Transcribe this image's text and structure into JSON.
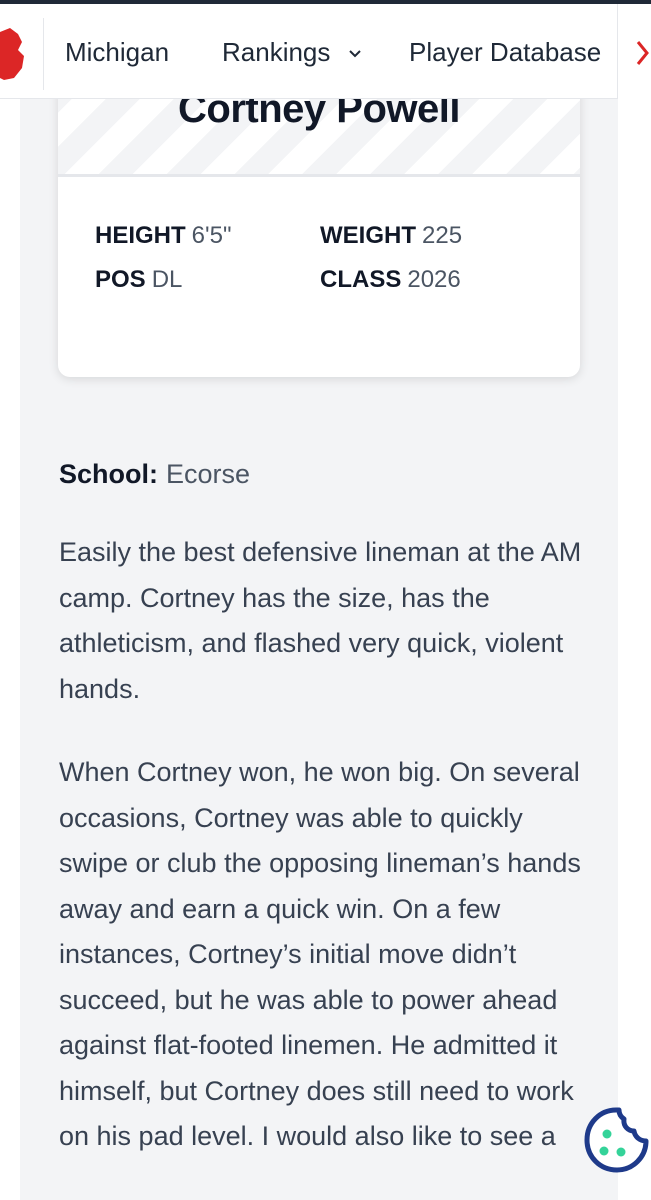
{
  "nav": {
    "items": [
      "Michigan",
      "Rankings",
      "Player Database"
    ]
  },
  "player": {
    "name": "Cortney Powell",
    "stats": [
      {
        "label": "HEIGHT",
        "value": "6'5\""
      },
      {
        "label": "WEIGHT",
        "value": "225"
      },
      {
        "label": "POS",
        "value": "DL"
      },
      {
        "label": "CLASS",
        "value": "2026"
      }
    ],
    "school_label": "School:",
    "school": "Ecorse"
  },
  "article": {
    "paragraphs": [
      "Easily the best defensive lineman at the AM camp. Cortney has the size, has the athleticism, and flashed very quick, violent hands.",
      "When Cortney won, he won big. On several occasions, Cortney was able to quickly swipe or club the opposing lineman’s hands away and earn a quick win. On a few instances, Cortney’s initial move didn’t succeed, but he was able to power ahead against flat-footed linemen. He admitted it himself, but Cortney does still need to work on his pad level. I would also like to see a"
    ]
  },
  "colors": {
    "brand_red": "#dc2626",
    "cookie_border": "#1e3a8a",
    "cookie_dots": "#34d399"
  }
}
